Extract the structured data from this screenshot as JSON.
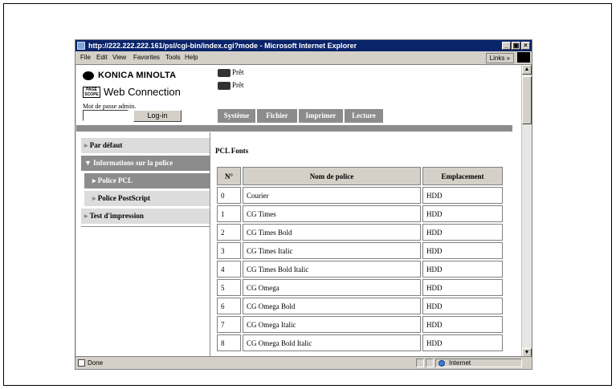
{
  "window": {
    "title": "http://222.222.222.161/psl/cgi-bin/index.cgi?mode - Microsoft Internet Explorer",
    "controls": [
      "_",
      "×"
    ]
  },
  "menu": [
    "File",
    "Edit",
    "View",
    "Favorites",
    "Tools",
    "Help"
  ],
  "links_label": "Links",
  "status_bar": {
    "text": "Done",
    "zone": "Internet"
  },
  "brand": {
    "name": "KONICA MINOLTA",
    "product": "Web Connection",
    "logo_text": "PAGE SCOPE"
  },
  "admin": {
    "password_label": "Mot de passe admin.",
    "login_button": "Log-in"
  },
  "printer_status": [
    "Prêt",
    "Prêt"
  ],
  "tabs": [
    "Système",
    "Fichier",
    "Imprimer",
    "Lecture"
  ],
  "nav": {
    "items": [
      {
        "label": "Par défaut",
        "prefix": "▸"
      },
      {
        "label": "Informations sur la police",
        "prefix": "▼"
      },
      {
        "label": "Police PCL",
        "prefix": "▸"
      },
      {
        "label": "Police PostScript",
        "prefix": "▸"
      },
      {
        "label": "Test d'impression",
        "prefix": "▸"
      }
    ]
  },
  "content": {
    "title": "PCL Fonts",
    "columns": [
      "N°",
      "Nom de police",
      "Emplacement"
    ],
    "rows": [
      [
        "0",
        "Courier",
        "HDD"
      ],
      [
        "1",
        "CG Times",
        "HDD"
      ],
      [
        "2",
        "CG Times Bold",
        "HDD"
      ],
      [
        "3",
        "CG Times Italic",
        "HDD"
      ],
      [
        "4",
        "CG Times Bold Italic",
        "HDD"
      ],
      [
        "5",
        "CG Omega",
        "HDD"
      ],
      [
        "6",
        "CG Omega Bold",
        "HDD"
      ],
      [
        "7",
        "CG Omega Italic",
        "HDD"
      ],
      [
        "8",
        "CG Omega Bold Italic",
        "HDD"
      ]
    ]
  },
  "colors": {
    "titlebar": "#0a246a",
    "tab_bg": "#8c8c8c",
    "nav_selected": "#8c8c8c",
    "nav_item": "#dcdcdc"
  }
}
